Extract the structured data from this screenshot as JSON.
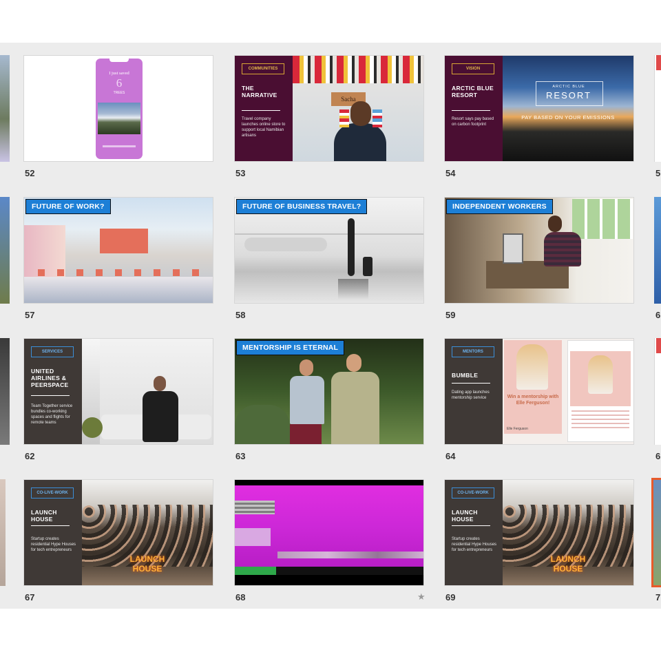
{
  "colors": {
    "selection": "#e85a2a",
    "tag_blue": "#1d7fd6",
    "plum": "#4a0e32",
    "charcoal": "#3f3936",
    "magenta": "#d62ad8"
  },
  "slides": [
    {
      "number": "52",
      "phone_line1": "I just saved",
      "phone_number": "6",
      "phone_line2": "TREES"
    },
    {
      "number": "53",
      "category": "COMMUNITIES",
      "title": "THE NARRATIVE",
      "desc": "Travel company launches online store to support local Namibian artisans",
      "sign": "Sacha"
    },
    {
      "number": "54",
      "category": "VISION",
      "title": "ARCTIC BLUE RESORT",
      "desc": "Resort says pay based on carbon footprint",
      "overlay_small": "ARCTIC BLUE",
      "overlay_big": "RESORT",
      "overlay_line": "PAY BASED ON YOUR EMISSIONS"
    },
    {
      "number": "57",
      "tag": "FUTURE OF WORK?"
    },
    {
      "number": "58",
      "tag": "FUTURE OF BUSINESS TRAVEL?"
    },
    {
      "number": "59",
      "tag": "INDEPENDENT WORKERS"
    },
    {
      "number": "62",
      "category": "SERVICES",
      "title": "UNITED AIRLINES & PEERSPACE",
      "desc": "Team Together service bundles co-working spaces and flights for remote teams"
    },
    {
      "number": "63",
      "tag": "MENTORSHIP IS ETERNAL"
    },
    {
      "number": "64",
      "category": "MENTORS",
      "title": "BUMBLE",
      "desc": "Dating app launches mentorship service",
      "promo": "Win a mentorship with Elle Ferguson!",
      "handle": "Elle Ferguson"
    },
    {
      "number": "67",
      "category": "CO-LIVE-WORK",
      "title": "LAUNCH HOUSE",
      "desc": "Startup creates residential Hype Houses for tech entrepreneurs",
      "neon": "LAUNCH HOUSE"
    },
    {
      "number": "68",
      "star": "★"
    },
    {
      "number": "69",
      "category": "CO-LIVE-WORK",
      "title": "LAUNCH HOUSE",
      "desc": "Startup creates residential Hype Houses for tech entrepreneurs",
      "neon": "LAUNCH HOUSE"
    }
  ],
  "edge_numbers": [
    "5",
    "6",
    "6",
    "7"
  ]
}
